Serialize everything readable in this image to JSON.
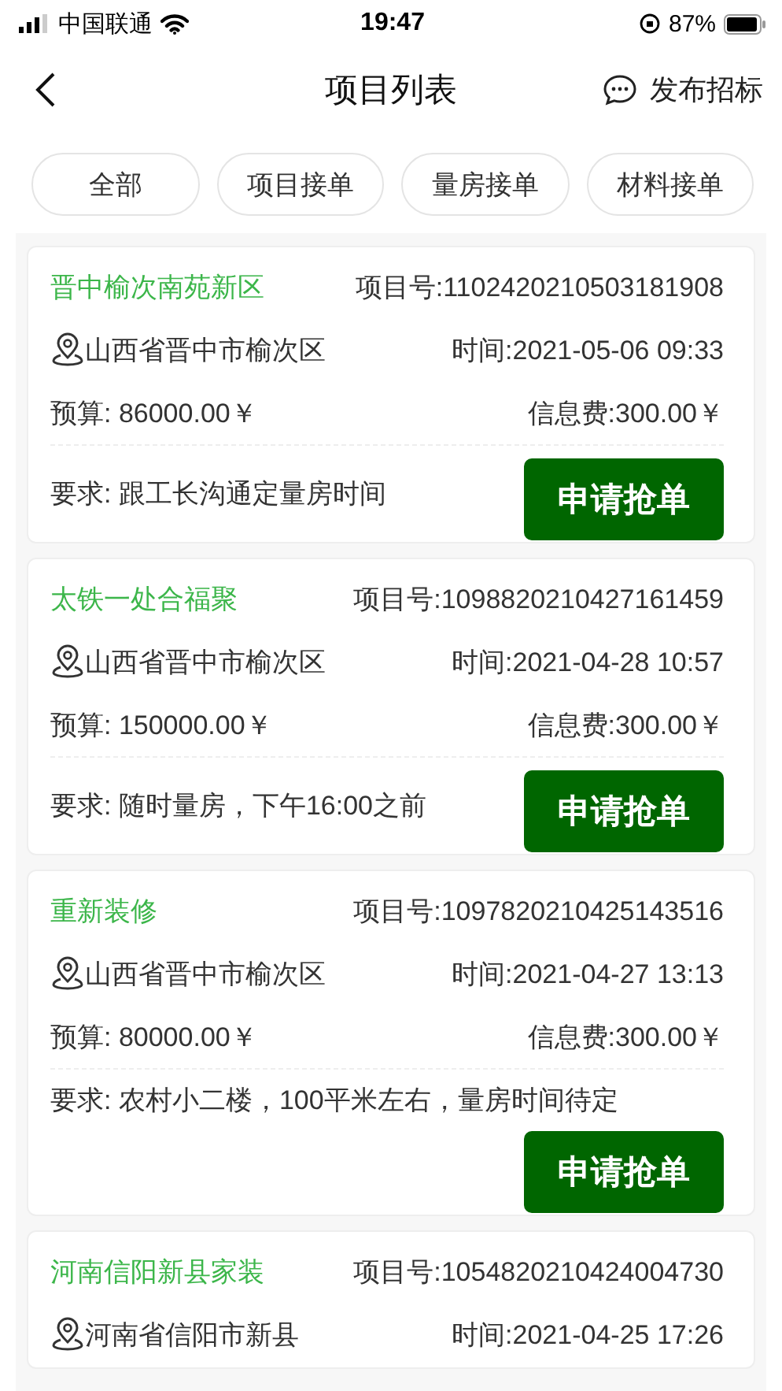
{
  "status_bar": {
    "carrier": "中国联通",
    "time": "19:47",
    "battery": "87%"
  },
  "nav": {
    "title": "项目列表",
    "action": "发布招标"
  },
  "filters": [
    {
      "label": "全部"
    },
    {
      "label": "项目接单"
    },
    {
      "label": "量房接单"
    },
    {
      "label": "材料接单"
    }
  ],
  "projects": [
    {
      "name": "晋中榆次南苑新区",
      "number": "项目号:1102420210503181908",
      "location": "山西省晋中市榆次区",
      "time": "时间:2021-05-06 09:33",
      "budget": "预算: 86000.00￥",
      "fee": "信息费:300.00￥",
      "requirement": "要求: 跟工长沟通定量房时间",
      "button": "申请抢单"
    },
    {
      "name": "太铁一处合福聚",
      "number": "项目号:1098820210427161459",
      "location": "山西省晋中市榆次区",
      "time": "时间:2021-04-28 10:57",
      "budget": "预算: 150000.00￥",
      "fee": "信息费:300.00￥",
      "requirement": "要求: 随时量房，下午16:00之前",
      "button": "申请抢单"
    },
    {
      "name": "重新装修",
      "number": "项目号:1097820210425143516",
      "location": "山西省晋中市榆次区",
      "time": "时间:2021-04-27 13:13",
      "budget": "预算: 80000.00￥",
      "fee": "信息费:300.00￥",
      "requirement": "要求: 农村小二楼，100平米左右，量房时间待定",
      "button": "申请抢单"
    },
    {
      "name": "河南信阳新县家装",
      "number": "项目号:1054820210424004730",
      "location": "河南省信阳市新县",
      "time": "时间:2021-04-25 17:26"
    }
  ]
}
